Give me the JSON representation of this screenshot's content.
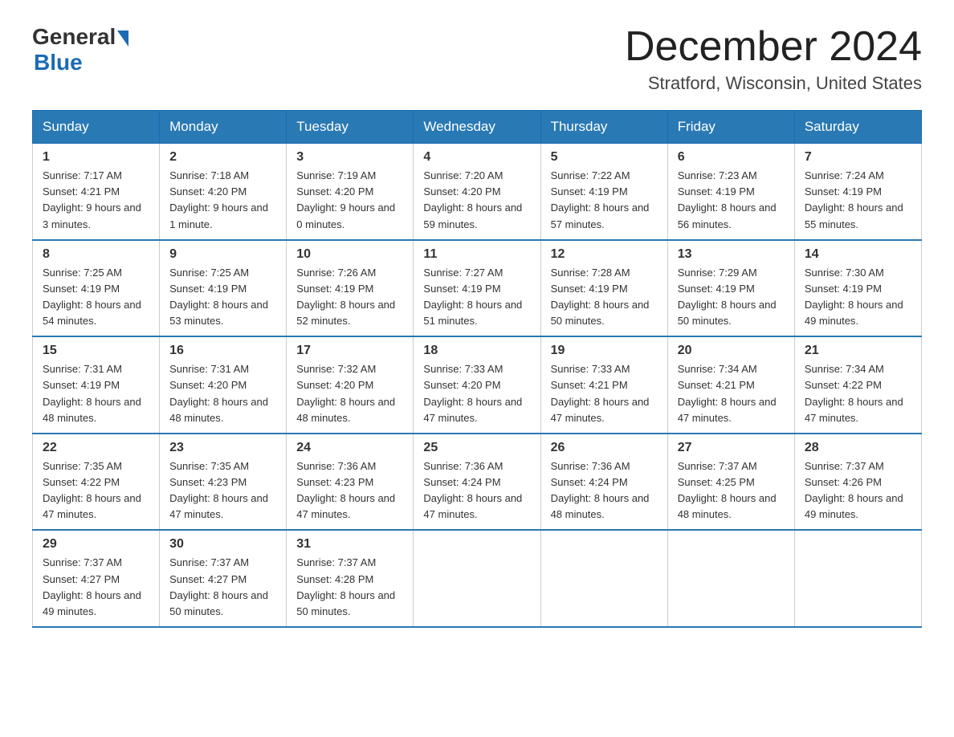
{
  "logo": {
    "general": "General",
    "blue": "Blue"
  },
  "title": "December 2024",
  "location": "Stratford, Wisconsin, United States",
  "days_of_week": [
    "Sunday",
    "Monday",
    "Tuesday",
    "Wednesday",
    "Thursday",
    "Friday",
    "Saturday"
  ],
  "weeks": [
    [
      {
        "day": "1",
        "sunrise": "7:17 AM",
        "sunset": "4:21 PM",
        "daylight": "9 hours and 3 minutes."
      },
      {
        "day": "2",
        "sunrise": "7:18 AM",
        "sunset": "4:20 PM",
        "daylight": "9 hours and 1 minute."
      },
      {
        "day": "3",
        "sunrise": "7:19 AM",
        "sunset": "4:20 PM",
        "daylight": "9 hours and 0 minutes."
      },
      {
        "day": "4",
        "sunrise": "7:20 AM",
        "sunset": "4:20 PM",
        "daylight": "8 hours and 59 minutes."
      },
      {
        "day": "5",
        "sunrise": "7:22 AM",
        "sunset": "4:19 PM",
        "daylight": "8 hours and 57 minutes."
      },
      {
        "day": "6",
        "sunrise": "7:23 AM",
        "sunset": "4:19 PM",
        "daylight": "8 hours and 56 minutes."
      },
      {
        "day": "7",
        "sunrise": "7:24 AM",
        "sunset": "4:19 PM",
        "daylight": "8 hours and 55 minutes."
      }
    ],
    [
      {
        "day": "8",
        "sunrise": "7:25 AM",
        "sunset": "4:19 PM",
        "daylight": "8 hours and 54 minutes."
      },
      {
        "day": "9",
        "sunrise": "7:25 AM",
        "sunset": "4:19 PM",
        "daylight": "8 hours and 53 minutes."
      },
      {
        "day": "10",
        "sunrise": "7:26 AM",
        "sunset": "4:19 PM",
        "daylight": "8 hours and 52 minutes."
      },
      {
        "day": "11",
        "sunrise": "7:27 AM",
        "sunset": "4:19 PM",
        "daylight": "8 hours and 51 minutes."
      },
      {
        "day": "12",
        "sunrise": "7:28 AM",
        "sunset": "4:19 PM",
        "daylight": "8 hours and 50 minutes."
      },
      {
        "day": "13",
        "sunrise": "7:29 AM",
        "sunset": "4:19 PM",
        "daylight": "8 hours and 50 minutes."
      },
      {
        "day": "14",
        "sunrise": "7:30 AM",
        "sunset": "4:19 PM",
        "daylight": "8 hours and 49 minutes."
      }
    ],
    [
      {
        "day": "15",
        "sunrise": "7:31 AM",
        "sunset": "4:19 PM",
        "daylight": "8 hours and 48 minutes."
      },
      {
        "day": "16",
        "sunrise": "7:31 AM",
        "sunset": "4:20 PM",
        "daylight": "8 hours and 48 minutes."
      },
      {
        "day": "17",
        "sunrise": "7:32 AM",
        "sunset": "4:20 PM",
        "daylight": "8 hours and 48 minutes."
      },
      {
        "day": "18",
        "sunrise": "7:33 AM",
        "sunset": "4:20 PM",
        "daylight": "8 hours and 47 minutes."
      },
      {
        "day": "19",
        "sunrise": "7:33 AM",
        "sunset": "4:21 PM",
        "daylight": "8 hours and 47 minutes."
      },
      {
        "day": "20",
        "sunrise": "7:34 AM",
        "sunset": "4:21 PM",
        "daylight": "8 hours and 47 minutes."
      },
      {
        "day": "21",
        "sunrise": "7:34 AM",
        "sunset": "4:22 PM",
        "daylight": "8 hours and 47 minutes."
      }
    ],
    [
      {
        "day": "22",
        "sunrise": "7:35 AM",
        "sunset": "4:22 PM",
        "daylight": "8 hours and 47 minutes."
      },
      {
        "day": "23",
        "sunrise": "7:35 AM",
        "sunset": "4:23 PM",
        "daylight": "8 hours and 47 minutes."
      },
      {
        "day": "24",
        "sunrise": "7:36 AM",
        "sunset": "4:23 PM",
        "daylight": "8 hours and 47 minutes."
      },
      {
        "day": "25",
        "sunrise": "7:36 AM",
        "sunset": "4:24 PM",
        "daylight": "8 hours and 47 minutes."
      },
      {
        "day": "26",
        "sunrise": "7:36 AM",
        "sunset": "4:24 PM",
        "daylight": "8 hours and 48 minutes."
      },
      {
        "day": "27",
        "sunrise": "7:37 AM",
        "sunset": "4:25 PM",
        "daylight": "8 hours and 48 minutes."
      },
      {
        "day": "28",
        "sunrise": "7:37 AM",
        "sunset": "4:26 PM",
        "daylight": "8 hours and 49 minutes."
      }
    ],
    [
      {
        "day": "29",
        "sunrise": "7:37 AM",
        "sunset": "4:27 PM",
        "daylight": "8 hours and 49 minutes."
      },
      {
        "day": "30",
        "sunrise": "7:37 AM",
        "sunset": "4:27 PM",
        "daylight": "8 hours and 50 minutes."
      },
      {
        "day": "31",
        "sunrise": "7:37 AM",
        "sunset": "4:28 PM",
        "daylight": "8 hours and 50 minutes."
      },
      null,
      null,
      null,
      null
    ]
  ],
  "colors": {
    "header_bg": "#2979b5",
    "header_text": "#ffffff",
    "border": "#2979b5",
    "cell_border": "#cccccc"
  }
}
